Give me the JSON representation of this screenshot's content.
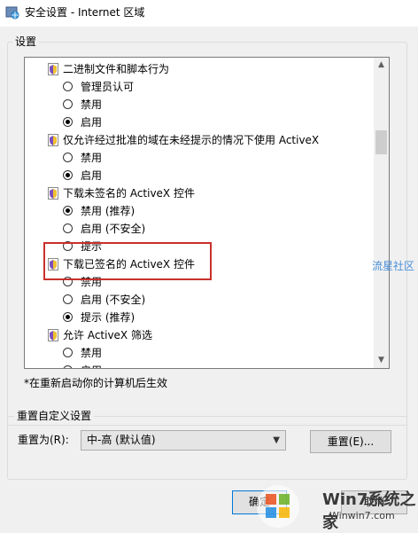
{
  "window": {
    "title": "安全设置 - Internet 区域",
    "icon": "shield-globe-icon"
  },
  "settings": {
    "group_label": "设置",
    "rows": [
      {
        "kind": "category",
        "label": "二进制文件和脚本行为"
      },
      {
        "kind": "option",
        "label": "管理员认可",
        "selected": false
      },
      {
        "kind": "option",
        "label": "禁用",
        "selected": false
      },
      {
        "kind": "option",
        "label": "启用",
        "selected": true
      },
      {
        "kind": "category",
        "label": "仅允许经过批准的域在未经提示的情况下使用 ActiveX"
      },
      {
        "kind": "option",
        "label": "禁用",
        "selected": false
      },
      {
        "kind": "option",
        "label": "启用",
        "selected": true
      },
      {
        "kind": "category",
        "label": "下载未签名的 ActiveX 控件"
      },
      {
        "kind": "option",
        "label": "禁用 (推荐)",
        "selected": true
      },
      {
        "kind": "option",
        "label": "启用 (不安全)",
        "selected": false
      },
      {
        "kind": "option",
        "label": "提示",
        "selected": false
      },
      {
        "kind": "category",
        "label": "下载已签名的 ActiveX 控件"
      },
      {
        "kind": "option",
        "label": "禁用",
        "selected": false
      },
      {
        "kind": "option",
        "label": "启用 (不安全)",
        "selected": false
      },
      {
        "kind": "option",
        "label": "提示 (推荐)",
        "selected": true
      },
      {
        "kind": "category",
        "label": "允许 ActiveX 筛选"
      },
      {
        "kind": "option",
        "label": "禁用",
        "selected": false
      },
      {
        "kind": "option",
        "label": "启用",
        "selected": true
      }
    ],
    "note": "*在重新启动你的计算机后生效"
  },
  "reset": {
    "group_label": "重置自定义设置",
    "reset_to_label": "重置为(R):",
    "selected_level": "中-高 (默认值)",
    "reset_button": "重置(E)..."
  },
  "buttons": {
    "ok": "确定",
    "cancel": "取消"
  },
  "watermarks": {
    "side": "流星社区",
    "main": "Win7系统之家",
    "url": "Winwin7.com"
  },
  "colors": {
    "highlight": "#c9302c",
    "watermark": "#4a90d9",
    "focus": "#0078d7"
  }
}
